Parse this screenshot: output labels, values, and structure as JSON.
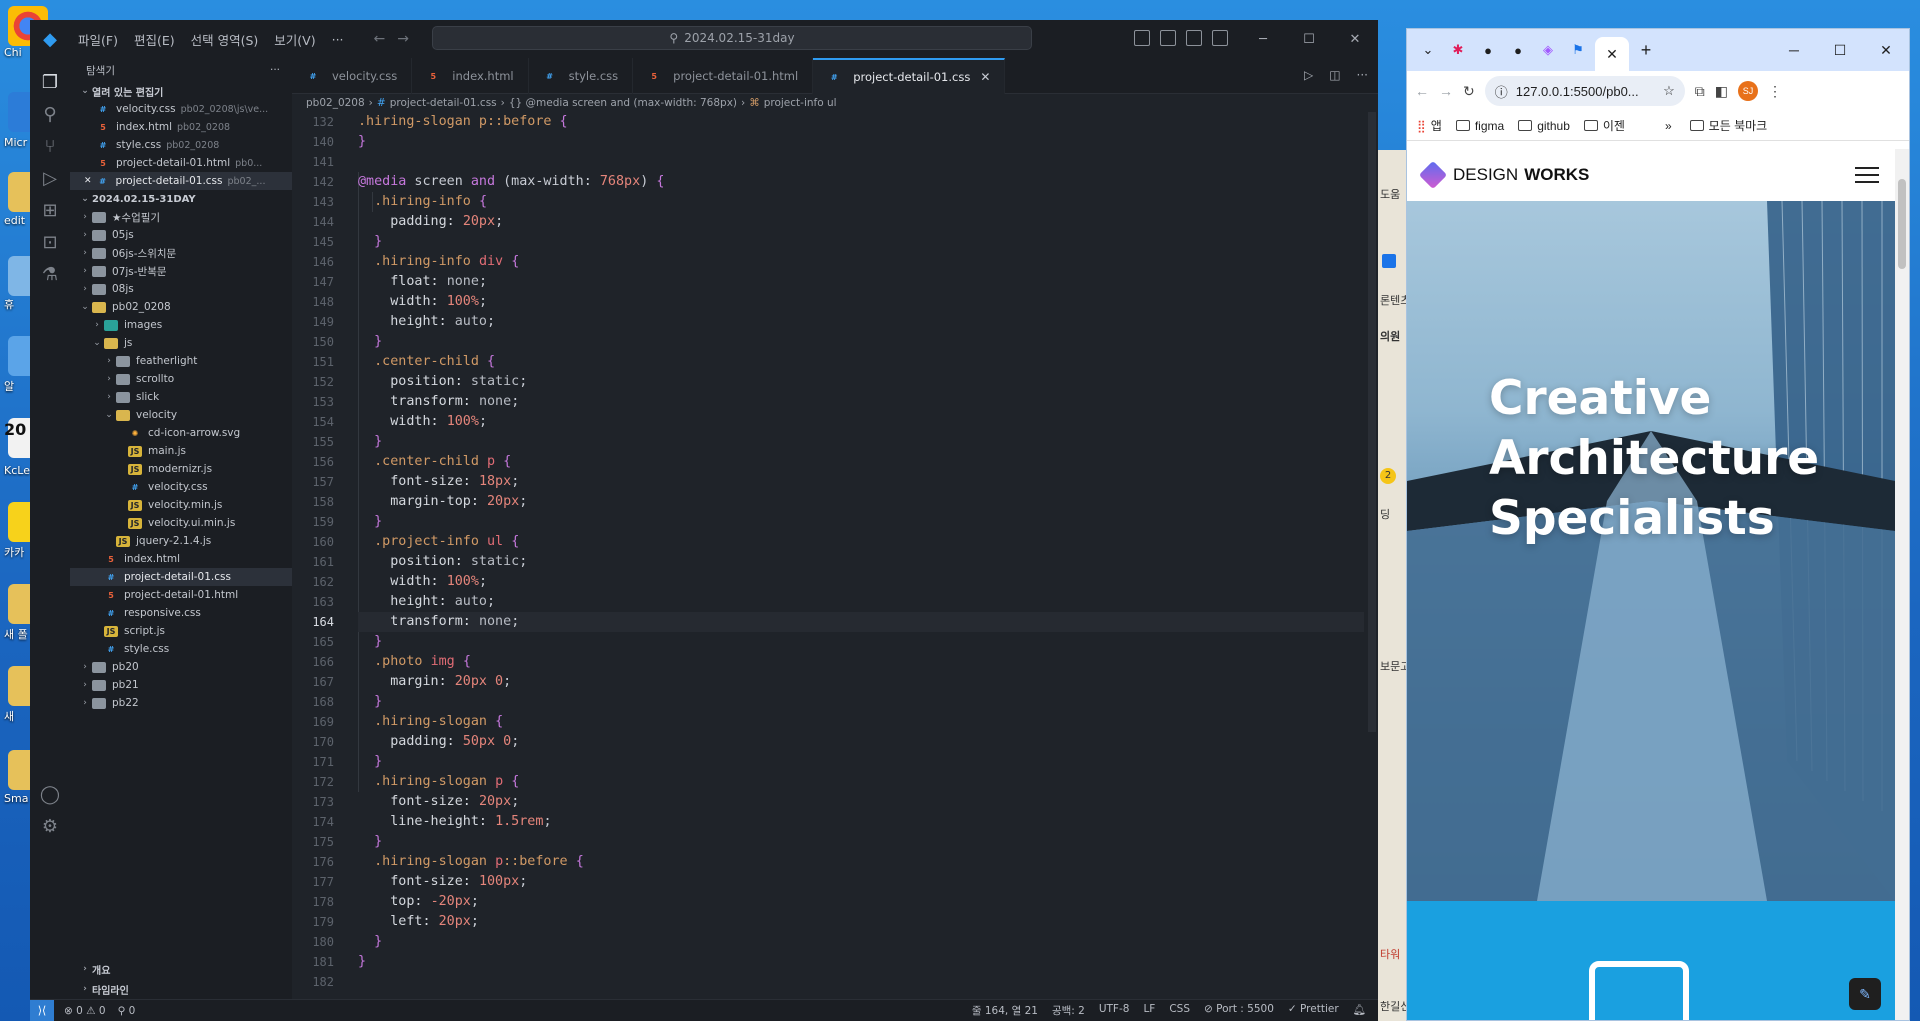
{
  "desktop": {
    "labels": [
      "Chi",
      "Micr",
      "edit",
      "휴",
      "알",
      "20",
      "KcLe 세무",
      "카카",
      "새 폴",
      "새",
      "Sma"
    ]
  },
  "vscode": {
    "menus": [
      "파일(F)",
      "편집(E)",
      "선택 영역(S)",
      "보기(V)",
      "···"
    ],
    "search_text": "2024.02.15-31day",
    "sidebar_title": "탐색기",
    "open_editors_header": "열려 있는 편집기",
    "open_editors": [
      {
        "name": "velocity.css",
        "path": "pb02_0208\\js\\ve...",
        "type": "css"
      },
      {
        "name": "index.html",
        "path": "pb02_0208",
        "type": "html"
      },
      {
        "name": "style.css",
        "path": "pb02_0208",
        "type": "css"
      },
      {
        "name": "project-detail-01.html",
        "path": "pb0...",
        "type": "html"
      },
      {
        "name": "project-detail-01.css",
        "path": "pb02_...",
        "type": "css"
      }
    ],
    "workspace_header": "2024.02.15-31DAY",
    "tree": [
      {
        "name": "★수업필기",
        "depth": 0,
        "kind": "folder"
      },
      {
        "name": "05js",
        "depth": 0,
        "kind": "folder"
      },
      {
        "name": "06js-스위치문",
        "depth": 0,
        "kind": "folder"
      },
      {
        "name": "07js-반복문",
        "depth": 0,
        "kind": "folder"
      },
      {
        "name": "08js",
        "depth": 0,
        "kind": "folder"
      },
      {
        "name": "pb02_0208",
        "depth": 0,
        "kind": "folder-open"
      },
      {
        "name": "images",
        "depth": 1,
        "kind": "img"
      },
      {
        "name": "js",
        "depth": 1,
        "kind": "folder-open"
      },
      {
        "name": "featherlight",
        "depth": 2,
        "kind": "folder"
      },
      {
        "name": "scrollto",
        "depth": 2,
        "kind": "folder"
      },
      {
        "name": "slick",
        "depth": 2,
        "kind": "folder"
      },
      {
        "name": "velocity",
        "depth": 2,
        "kind": "folder-open"
      },
      {
        "name": "cd-icon-arrow.svg",
        "depth": 3,
        "kind": "svg"
      },
      {
        "name": "main.js",
        "depth": 3,
        "kind": "js"
      },
      {
        "name": "modernizr.js",
        "depth": 3,
        "kind": "js"
      },
      {
        "name": "velocity.css",
        "depth": 3,
        "kind": "css"
      },
      {
        "name": "velocity.min.js",
        "depth": 3,
        "kind": "js"
      },
      {
        "name": "velocity.ui.min.js",
        "depth": 3,
        "kind": "js"
      },
      {
        "name": "jquery-2.1.4.js",
        "depth": 2,
        "kind": "js"
      },
      {
        "name": "index.html",
        "depth": 1,
        "kind": "html"
      },
      {
        "name": "project-detail-01.css",
        "depth": 1,
        "kind": "css",
        "selected": true
      },
      {
        "name": "project-detail-01.html",
        "depth": 1,
        "kind": "html"
      },
      {
        "name": "responsive.css",
        "depth": 1,
        "kind": "css"
      },
      {
        "name": "script.js",
        "depth": 1,
        "kind": "js"
      },
      {
        "name": "style.css",
        "depth": 1,
        "kind": "css"
      },
      {
        "name": "pb20",
        "depth": 0,
        "kind": "folder"
      },
      {
        "name": "pb21",
        "depth": 0,
        "kind": "folder"
      },
      {
        "name": "pb22",
        "depth": 0,
        "kind": "folder"
      }
    ],
    "outline_header": "개요",
    "timeline_header": "타임라인",
    "tabs": [
      {
        "label": "velocity.css",
        "type": "css"
      },
      {
        "label": "index.html",
        "type": "html"
      },
      {
        "label": "style.css",
        "type": "css"
      },
      {
        "label": "project-detail-01.html",
        "type": "html"
      },
      {
        "label": "project-detail-01.css",
        "type": "css",
        "active": true
      }
    ],
    "breadcrumb": [
      "pb02_0208",
      "project-detail-01.css",
      "{} @media screen and (max-width: 768px)",
      "project-info ul"
    ],
    "current_line": 164,
    "code_lines": [
      {
        "n": 132,
        "t": [
          [
            "sel",
            ".hiring-slogan p::before "
          ],
          [
            "brace",
            "{"
          ]
        ]
      },
      {
        "n": 140,
        "t": [
          [
            "brace",
            "}"
          ]
        ]
      },
      {
        "n": 141,
        "t": []
      },
      {
        "n": 142,
        "t": [
          [
            "kw",
            "@media"
          ],
          [
            "plain",
            " screen "
          ],
          [
            "kw",
            "and"
          ],
          [
            "plain",
            " (max-width: "
          ],
          [
            "num",
            "768px"
          ],
          [
            "plain",
            ") "
          ],
          [
            "brace",
            "{"
          ]
        ]
      },
      {
        "n": 143,
        "t": [
          [
            "plain",
            "  "
          ],
          [
            "sel",
            ".hiring-info "
          ],
          [
            "brace",
            "{"
          ]
        ]
      },
      {
        "n": 144,
        "t": [
          [
            "prop",
            "    padding: "
          ],
          [
            "num",
            "20px"
          ],
          [
            "plain",
            ";"
          ]
        ]
      },
      {
        "n": 145,
        "t": [
          [
            "plain",
            "  "
          ],
          [
            "brace",
            "}"
          ]
        ]
      },
      {
        "n": 146,
        "t": [
          [
            "plain",
            "  "
          ],
          [
            "sel",
            ".hiring-info "
          ],
          [
            "tag",
            "div "
          ],
          [
            "brace",
            "{"
          ]
        ]
      },
      {
        "n": 147,
        "t": [
          [
            "prop",
            "    float: "
          ],
          [
            "val",
            "none"
          ],
          [
            "plain",
            ";"
          ]
        ]
      },
      {
        "n": 148,
        "t": [
          [
            "prop",
            "    width: "
          ],
          [
            "num",
            "100%"
          ],
          [
            "plain",
            ";"
          ]
        ]
      },
      {
        "n": 149,
        "t": [
          [
            "prop",
            "    height: "
          ],
          [
            "val",
            "auto"
          ],
          [
            "plain",
            ";"
          ]
        ]
      },
      {
        "n": 150,
        "t": [
          [
            "plain",
            "  "
          ],
          [
            "brace",
            "}"
          ]
        ]
      },
      {
        "n": 151,
        "t": [
          [
            "plain",
            "  "
          ],
          [
            "sel",
            ".center-child "
          ],
          [
            "brace",
            "{"
          ]
        ]
      },
      {
        "n": 152,
        "t": [
          [
            "prop",
            "    position: "
          ],
          [
            "val",
            "static"
          ],
          [
            "plain",
            ";"
          ]
        ]
      },
      {
        "n": 153,
        "t": [
          [
            "prop",
            "    transform: "
          ],
          [
            "val",
            "none"
          ],
          [
            "plain",
            ";"
          ]
        ]
      },
      {
        "n": 154,
        "t": [
          [
            "prop",
            "    width: "
          ],
          [
            "num",
            "100%"
          ],
          [
            "plain",
            ";"
          ]
        ]
      },
      {
        "n": 155,
        "t": [
          [
            "plain",
            "  "
          ],
          [
            "brace",
            "}"
          ]
        ]
      },
      {
        "n": 156,
        "t": [
          [
            "plain",
            "  "
          ],
          [
            "sel",
            ".center-child "
          ],
          [
            "tag",
            "p "
          ],
          [
            "brace",
            "{"
          ]
        ]
      },
      {
        "n": 157,
        "t": [
          [
            "prop",
            "    font-size: "
          ],
          [
            "num",
            "18px"
          ],
          [
            "plain",
            ";"
          ]
        ]
      },
      {
        "n": 158,
        "t": [
          [
            "prop",
            "    margin-top: "
          ],
          [
            "num",
            "20px"
          ],
          [
            "plain",
            ";"
          ]
        ]
      },
      {
        "n": 159,
        "t": [
          [
            "plain",
            "  "
          ],
          [
            "brace",
            "}"
          ]
        ]
      },
      {
        "n": 160,
        "t": [
          [
            "plain",
            "  "
          ],
          [
            "sel",
            ".project-info "
          ],
          [
            "tag",
            "ul "
          ],
          [
            "brace",
            "{"
          ]
        ]
      },
      {
        "n": 161,
        "t": [
          [
            "prop",
            "    position: "
          ],
          [
            "val",
            "static"
          ],
          [
            "plain",
            ";"
          ]
        ]
      },
      {
        "n": 162,
        "t": [
          [
            "prop",
            "    width: "
          ],
          [
            "num",
            "100%"
          ],
          [
            "plain",
            ";"
          ]
        ]
      },
      {
        "n": 163,
        "t": [
          [
            "prop",
            "    height: "
          ],
          [
            "val",
            "auto"
          ],
          [
            "plain",
            ";"
          ]
        ]
      },
      {
        "n": 164,
        "t": [
          [
            "prop",
            "    transform: "
          ],
          [
            "val",
            "none"
          ],
          [
            "plain",
            ";"
          ]
        ]
      },
      {
        "n": 165,
        "t": [
          [
            "plain",
            "  "
          ],
          [
            "brace",
            "}"
          ]
        ]
      },
      {
        "n": 166,
        "t": [
          [
            "plain",
            "  "
          ],
          [
            "sel",
            ".photo "
          ],
          [
            "tag",
            "img "
          ],
          [
            "brace",
            "{"
          ]
        ]
      },
      {
        "n": 167,
        "t": [
          [
            "prop",
            "    margin: "
          ],
          [
            "num",
            "20px 0"
          ],
          [
            "plain",
            ";"
          ]
        ]
      },
      {
        "n": 168,
        "t": [
          [
            "plain",
            "  "
          ],
          [
            "brace",
            "}"
          ]
        ]
      },
      {
        "n": 169,
        "t": [
          [
            "plain",
            "  "
          ],
          [
            "sel",
            ".hiring-slogan "
          ],
          [
            "brace",
            "{"
          ]
        ]
      },
      {
        "n": 170,
        "t": [
          [
            "prop",
            "    padding: "
          ],
          [
            "num",
            "50px 0"
          ],
          [
            "plain",
            ";"
          ]
        ]
      },
      {
        "n": 171,
        "t": [
          [
            "plain",
            "  "
          ],
          [
            "brace",
            "}"
          ]
        ]
      },
      {
        "n": 172,
        "t": [
          [
            "plain",
            "  "
          ],
          [
            "sel",
            ".hiring-slogan "
          ],
          [
            "tag",
            "p "
          ],
          [
            "brace",
            "{"
          ]
        ]
      },
      {
        "n": 173,
        "t": [
          [
            "prop",
            "    font-size: "
          ],
          [
            "num",
            "20px"
          ],
          [
            "plain",
            ";"
          ]
        ]
      },
      {
        "n": 174,
        "t": [
          [
            "prop",
            "    line-height: "
          ],
          [
            "num",
            "1.5rem"
          ],
          [
            "plain",
            ";"
          ]
        ]
      },
      {
        "n": 175,
        "t": [
          [
            "plain",
            "  "
          ],
          [
            "brace",
            "}"
          ]
        ]
      },
      {
        "n": 176,
        "t": [
          [
            "plain",
            "  "
          ],
          [
            "sel",
            ".hiring-slogan "
          ],
          [
            "tag",
            "p"
          ],
          [
            "sel",
            "::before "
          ],
          [
            "brace",
            "{"
          ]
        ]
      },
      {
        "n": 177,
        "t": [
          [
            "prop",
            "    font-size: "
          ],
          [
            "num",
            "100px"
          ],
          [
            "plain",
            ";"
          ]
        ]
      },
      {
        "n": 178,
        "t": [
          [
            "prop",
            "    top: "
          ],
          [
            "num",
            "-20px"
          ],
          [
            "plain",
            ";"
          ]
        ]
      },
      {
        "n": 179,
        "t": [
          [
            "prop",
            "    left: "
          ],
          [
            "num",
            "20px"
          ],
          [
            "plain",
            ";"
          ]
        ]
      },
      {
        "n": 180,
        "t": [
          [
            "plain",
            "  "
          ],
          [
            "brace",
            "}"
          ]
        ]
      },
      {
        "n": 181,
        "t": [
          [
            "brace",
            "}"
          ]
        ]
      },
      {
        "n": 182,
        "t": []
      }
    ],
    "status": {
      "problems": "⊗ 0 ⚠ 0",
      "ports": "⚲ 0",
      "position": "줄 164, 열 21",
      "spaces": "공백: 2",
      "encoding": "UTF-8",
      "eol": "LF",
      "language": "CSS",
      "port": "⊘ Port : 5500",
      "prettier": "✓ Prettier"
    }
  },
  "map": {
    "labels": [
      "도움",
      "론텐츠",
      "의원",
      "2",
      "딩",
      "보문고",
      "타워",
      "한길신"
    ]
  },
  "chrome": {
    "url": "127.0.0.1:5500/pb0...",
    "profile_initials": "SJ",
    "bookmarks": [
      "앱",
      "figma",
      "github",
      "이젠"
    ],
    "all_bookmarks": "모든 북마크",
    "site": {
      "logo_light": "DESIGN ",
      "logo_bold": "WORKS",
      "hero_lines": [
        "Creative",
        "Architecture",
        "Specialists"
      ]
    }
  }
}
